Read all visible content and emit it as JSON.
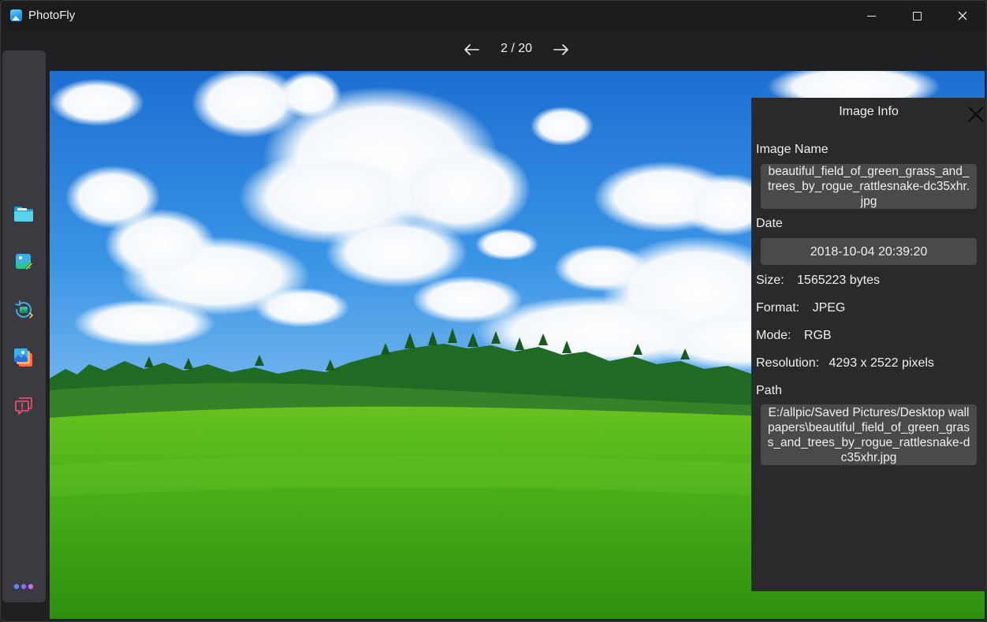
{
  "window": {
    "title": "PhotoFly"
  },
  "nav": {
    "counter": "2 / 20"
  },
  "sidebar": {
    "items": [
      {
        "name": "folder-icon"
      },
      {
        "name": "image-edit-icon"
      },
      {
        "name": "image-rotate-icon"
      },
      {
        "name": "gallery-stack-icon"
      },
      {
        "name": "feedback-icon"
      },
      {
        "name": "more-icon"
      }
    ]
  },
  "info": {
    "title": "Image Info",
    "image_name_label": "Image Name",
    "image_name": "beautiful_field_of_green_grass_and_trees_by_rogue_rattlesnake-dc35xhr.jpg",
    "date_label": "Date",
    "date": "2018-10-04 20:39:20",
    "size_label": "Size:",
    "size": "1565223 bytes",
    "format_label": "Format:",
    "format": "JPEG",
    "mode_label": "Mode:",
    "mode": "RGB",
    "resolution_label": "Resolution:",
    "resolution": "4293 x 2522 pixels",
    "path_label": "Path",
    "path": "E:/allpic/Saved Pictures/Desktop wallpapers\\beautiful_field_of_green_grass_and_trees_by_rogue_rattlesnake-dc35xhr.jpg"
  },
  "colors": {
    "background": "#202022",
    "sidebar": "#3b3a40",
    "panel": "#2a2a2c",
    "field": "#4a4a4d",
    "sky": "#2f8de0",
    "grass": "#4caf1e"
  }
}
